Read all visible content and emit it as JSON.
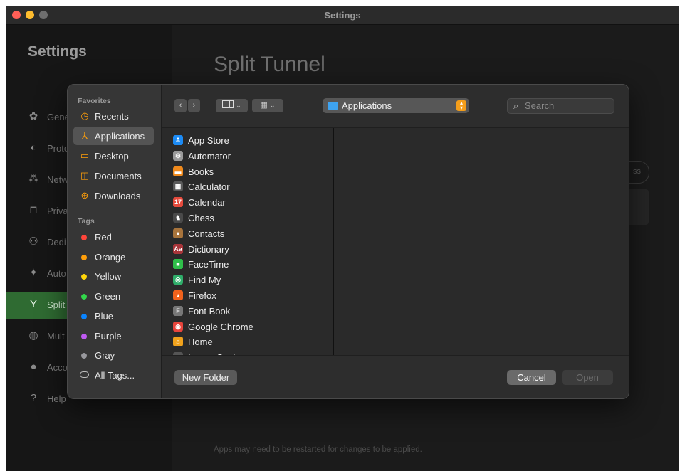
{
  "window": {
    "title": "Settings",
    "traffic_colors": [
      "#ff5f57",
      "#febc2e",
      "#6e6e6e"
    ]
  },
  "settings": {
    "sidebar_title": "Settings",
    "nav": [
      {
        "label": "Gene",
        "icon": "gear-icon"
      },
      {
        "label": "Proto",
        "icon": "protocol-icon"
      },
      {
        "label": "Netw",
        "icon": "network-icon"
      },
      {
        "label": "Priva",
        "icon": "lock-icon"
      },
      {
        "label": "Dedi",
        "icon": "dedicated-ip-icon"
      },
      {
        "label": "Auto",
        "icon": "automation-icon"
      },
      {
        "label": "Split",
        "icon": "split-tunnel-icon"
      },
      {
        "label": "Mult",
        "icon": "multihop-icon"
      },
      {
        "label": "Acco",
        "icon": "account-icon"
      },
      {
        "label": "Help",
        "icon": "help-icon"
      }
    ],
    "active_nav": "Split",
    "accent_color": "#2f6b32",
    "main_title": "Split Tunnel",
    "ghost_button_label": "ss",
    "footer_note": "Apps may need to be restarted for changes to be applied."
  },
  "dialog": {
    "favorites_header": "Favorites",
    "favorites": [
      {
        "label": "Recents",
        "icon": "clock-icon",
        "selected": false
      },
      {
        "label": "Applications",
        "icon": "applications-icon",
        "selected": true
      },
      {
        "label": "Desktop",
        "icon": "desktop-icon",
        "selected": false
      },
      {
        "label": "Documents",
        "icon": "document-icon",
        "selected": false
      },
      {
        "label": "Downloads",
        "icon": "download-icon",
        "selected": false
      }
    ],
    "tags_header": "Tags",
    "tags": [
      {
        "label": "Red",
        "color": "#ff453a"
      },
      {
        "label": "Orange",
        "color": "#ff9f0a"
      },
      {
        "label": "Yellow",
        "color": "#ffd60a"
      },
      {
        "label": "Green",
        "color": "#32d74b"
      },
      {
        "label": "Blue",
        "color": "#0a84ff"
      },
      {
        "label": "Purple",
        "color": "#bf5af2"
      },
      {
        "label": "Gray",
        "color": "#98989d"
      },
      {
        "label": "All Tags...",
        "color": ""
      }
    ],
    "toolbar": {
      "view_icons": [
        "column-view-icon",
        "grid-view-icon"
      ]
    },
    "location": "Applications",
    "search_placeholder": "Search",
    "files": [
      {
        "label": "App Store",
        "icon": "app-store-icon",
        "color": "#1c8bf5",
        "glyph": "A"
      },
      {
        "label": "Automator",
        "icon": "automator-icon",
        "color": "#9a9a9a",
        "glyph": "⚙"
      },
      {
        "label": "Books",
        "icon": "books-icon",
        "color": "#f08a1c",
        "glyph": "▬"
      },
      {
        "label": "Calculator",
        "icon": "calculator-icon",
        "color": "#5a5a5a",
        "glyph": "▦"
      },
      {
        "label": "Calendar",
        "icon": "calendar-icon",
        "color": "#e54a3c",
        "glyph": "17"
      },
      {
        "label": "Chess",
        "icon": "chess-icon",
        "color": "#4a4a4a",
        "glyph": "♞"
      },
      {
        "label": "Contacts",
        "icon": "contacts-icon",
        "color": "#a8743c",
        "glyph": "●"
      },
      {
        "label": "Dictionary",
        "icon": "dictionary-icon",
        "color": "#a8353a",
        "glyph": "Aa"
      },
      {
        "label": "FaceTime",
        "icon": "facetime-icon",
        "color": "#2fbf4a",
        "glyph": "■"
      },
      {
        "label": "Find My",
        "icon": "find-my-icon",
        "color": "#2fae6a",
        "glyph": "◎"
      },
      {
        "label": "Firefox",
        "icon": "firefox-icon",
        "color": "#f0621c",
        "glyph": "◕"
      },
      {
        "label": "Font Book",
        "icon": "font-book-icon",
        "color": "#777777",
        "glyph": "F"
      },
      {
        "label": "Google Chrome",
        "icon": "chrome-icon",
        "color": "#e8453c",
        "glyph": "◉"
      },
      {
        "label": "Home",
        "icon": "home-icon",
        "color": "#f0a21c",
        "glyph": "⌂"
      },
      {
        "label": "Image Capture",
        "icon": "image-capture-icon",
        "color": "#555555",
        "glyph": "▤"
      }
    ],
    "new_folder_label": "New Folder",
    "cancel_label": "Cancel",
    "open_label": "Open"
  }
}
